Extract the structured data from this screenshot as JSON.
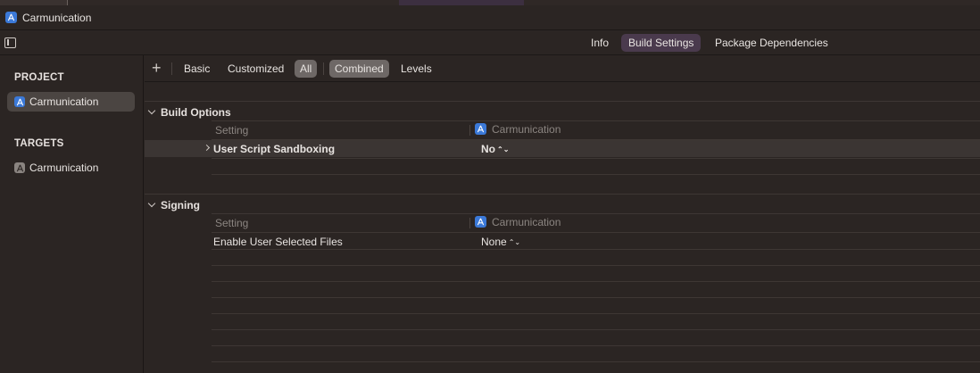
{
  "window": {
    "title": "Carmunication"
  },
  "tabs": [
    {
      "label": "Info",
      "active": false
    },
    {
      "label": "Build Settings",
      "active": true
    },
    {
      "label": "Package Dependencies",
      "active": false
    }
  ],
  "sidebar": {
    "project_header": "PROJECT",
    "project_items": [
      {
        "label": "Carmunication",
        "icon": "xcode-project-icon",
        "selected": true
      }
    ],
    "targets_header": "TARGETS",
    "target_items": [
      {
        "label": "Carmunication",
        "icon": "app-target-icon",
        "selected": false
      }
    ]
  },
  "toolbar": {
    "add_label": "+",
    "filters": [
      {
        "label": "Basic",
        "selected": false
      },
      {
        "label": "Customized",
        "selected": false
      },
      {
        "label": "All",
        "selected": true
      }
    ],
    "views": [
      {
        "label": "Combined",
        "selected": true
      },
      {
        "label": "Levels",
        "selected": false
      }
    ]
  },
  "groups": [
    {
      "title": "Build Options",
      "setting_column": "Setting",
      "target_column": "Carmunication",
      "rows": [
        {
          "name": "User Script Sandboxing",
          "value": "No",
          "expandable": true,
          "bold": true
        }
      ]
    },
    {
      "title": "Signing",
      "setting_column": "Setting",
      "target_column": "Carmunication",
      "rows": [
        {
          "name": "Enable User Selected Files",
          "value": "None",
          "expandable": false,
          "bold": false
        }
      ]
    }
  ],
  "colors": {
    "background": "#2b2523",
    "accent_tab": "#4a3a4d",
    "app_icon": "#3b79d8",
    "selected_item": "#4b4542"
  }
}
